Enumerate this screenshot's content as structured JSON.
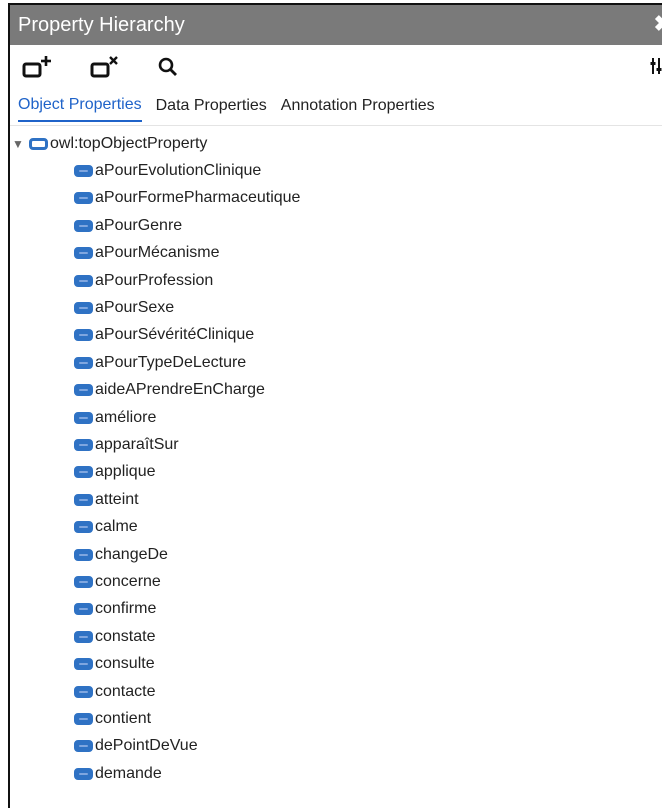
{
  "window": {
    "title": "Property Hierarchy",
    "close_glyph": "✖"
  },
  "toolbar": {
    "buttons": [
      {
        "name": "add-sub-property-icon",
        "badge": "+"
      },
      {
        "name": "delete-property-icon",
        "badge": "x"
      },
      {
        "name": "search-icon"
      }
    ],
    "options_icon": "sliders-icon"
  },
  "tabs": [
    {
      "label": "Object Properties",
      "active": true
    },
    {
      "label": "Data Properties",
      "active": false
    },
    {
      "label": "Annotation Properties",
      "active": false
    }
  ],
  "tree": {
    "root": {
      "label": "owl:topObjectProperty",
      "expanded": true,
      "expander_glyph": "▼"
    },
    "children": [
      "aPourEvolutionClinique",
      "aPourFormePharmaceutique",
      "aPourGenre",
      "aPourMécanisme",
      "aPourProfession",
      "aPourSexe",
      "aPourSévéritéClinique",
      "aPourTypeDeLecture",
      "aideAPrendreEnCharge",
      "améliore",
      "apparaîtSur",
      "applique",
      "atteint",
      "calme",
      "changeDe",
      "concerne",
      "confirme",
      "constate",
      "consulte",
      "contacte",
      "contient",
      "dePointDeVue",
      "demande"
    ]
  },
  "colors": {
    "titlebar": "#7a7a7a",
    "accent": "#1f63c9",
    "property_icon": "#2f72c4"
  }
}
